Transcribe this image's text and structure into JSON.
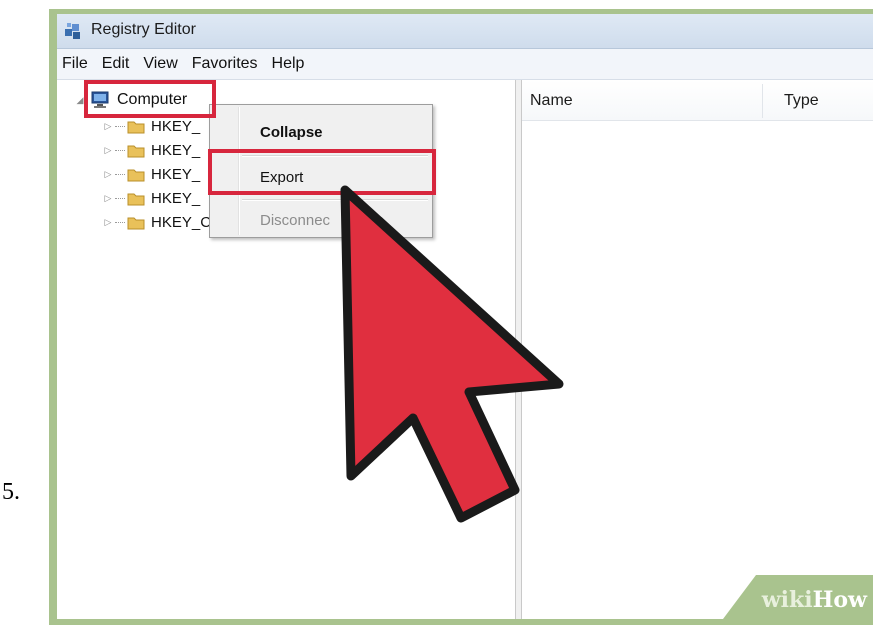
{
  "step_number": "5.",
  "window": {
    "title": "Registry Editor",
    "icon": "registry-editor-icon"
  },
  "menubar": {
    "items": [
      "File",
      "Edit",
      "View",
      "Favorites",
      "Help"
    ]
  },
  "tree": {
    "root_label": "Computer",
    "root_icon": "computer-icon",
    "hives": [
      {
        "label": "HKEY_"
      },
      {
        "label": "HKEY_"
      },
      {
        "label": "HKEY_"
      },
      {
        "label": "HKEY_"
      },
      {
        "label": "HKEY_CURRENT_CONFIG"
      }
    ]
  },
  "context_menu": {
    "items": [
      {
        "label": "Collapse",
        "bold": true
      },
      {
        "label": "Export"
      },
      {
        "label": "Disconnec",
        "disabled": true
      }
    ]
  },
  "list": {
    "columns": [
      "Name",
      "Type"
    ]
  },
  "watermark": {
    "wiki": "wiki",
    "how": "How"
  },
  "colors": {
    "highlight": "#d7263d",
    "cursor_fill": "#e02f3f",
    "frame": "#a9c38e"
  }
}
